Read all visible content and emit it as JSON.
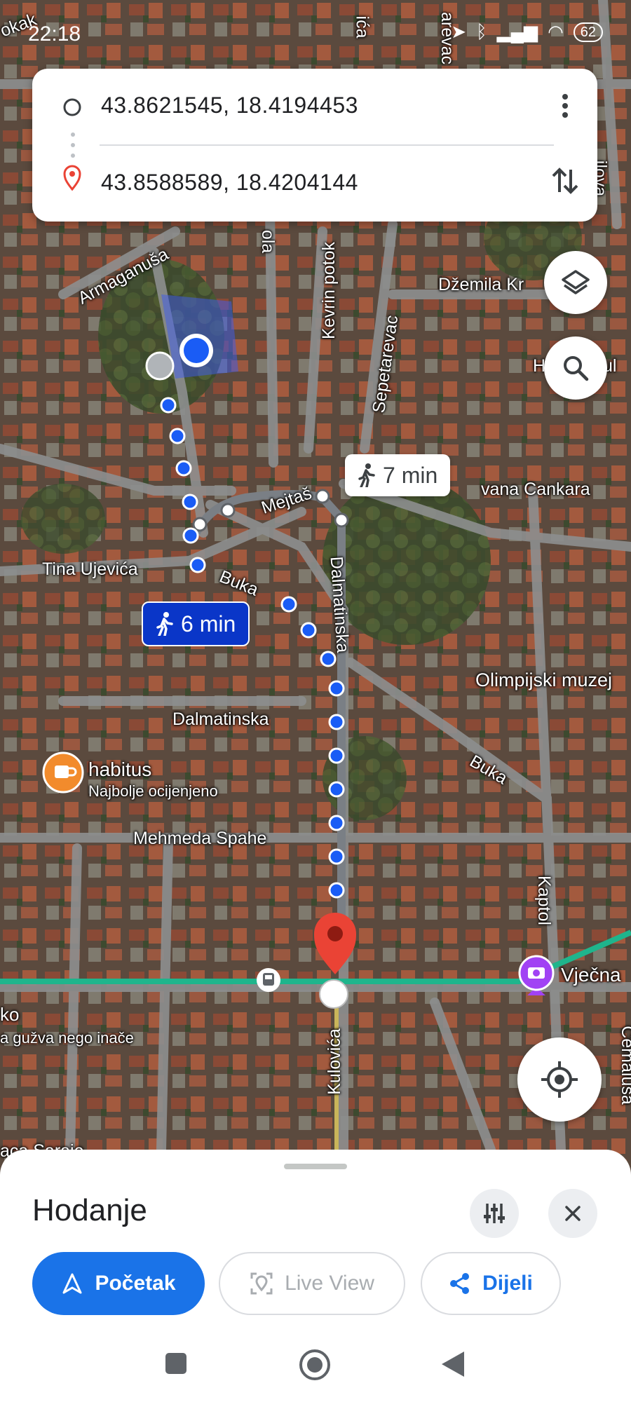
{
  "status_bar": {
    "time": "22:18",
    "battery": "62"
  },
  "route_card": {
    "origin": "43.8621545, 18.4194453",
    "destination": "43.8588589, 18.4204144",
    "more_icon": "more-vert-icon",
    "swap_icon": "swap-icon"
  },
  "map": {
    "streets": {
      "armaganusa": "Armaganuša",
      "dzemila": "Džemila Kr",
      "kevrin_potok": "Kevrin potok",
      "sepetarevac": "Sepetarevac",
      "mejtas": "Mejtaš",
      "ivana_cankara": "vana Cankara",
      "tina_ujevica": "Tina Ujevića",
      "buka_1": "Buka",
      "dalmatinska_v": "Dalmatinska",
      "dalmatinska_h": "Dalmatinska",
      "buka_2": "Buka",
      "mehmeda_spahe": "Mehmeda Spahe",
      "kaptol": "Kaptol",
      "kulovica": "Kulovića",
      "cemalusa": "Cemaluša",
      "sarajevo": "aca Saraje",
      "top_left": "okak",
      "top_right": "arevac",
      "right_ul": "ul",
      "right_ilova": "ilova",
      "right_h": "H",
      "ola": "ola",
      "ica": "ića"
    },
    "pois": {
      "olimpijski": "Olimpijski muzej",
      "habitus_name": "habitus",
      "habitus_sub": "Najbolje ocijenjeno",
      "vjecna": "Vječna",
      "traffic_1": "ko",
      "traffic_2": "a gužva nego inače"
    },
    "route_alt": {
      "time": "7 min"
    },
    "route_main": {
      "time": "6 min"
    }
  },
  "bottom_sheet": {
    "title": "Hodanje",
    "start_label": "Početak",
    "liveview_label": "Live View",
    "share_label": "Dijeli"
  },
  "colors": {
    "accent": "#1a73e8",
    "route_blue": "#1a5cf5",
    "pin_red": "#ea4335",
    "transit_green": "#1fb58c"
  }
}
